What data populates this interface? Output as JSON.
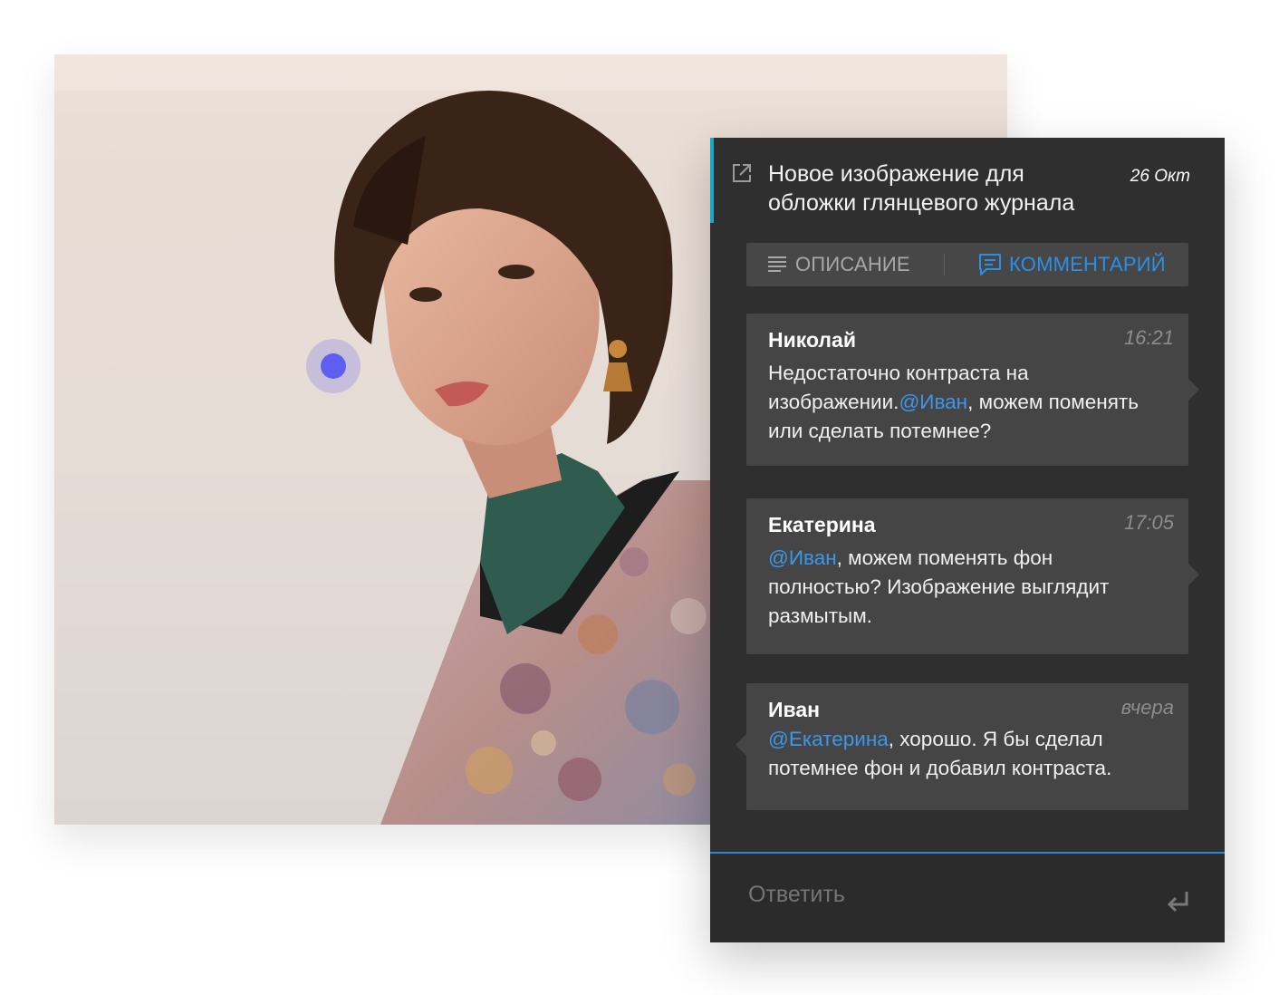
{
  "photo": {
    "annotation_pin_color": "#5f5ef0"
  },
  "panel": {
    "open_icon": "external-link-icon",
    "title": "Новое изображение для обложки глянцевого журнала",
    "date": "26 Окт",
    "accent_color": "#17a8c7",
    "tabs": [
      {
        "label": "ОПИСАНИЕ",
        "icon": "text-lines-icon",
        "active": false
      },
      {
        "label": "КОММЕНТАРИЙ",
        "icon": "comment-icon",
        "active": true
      }
    ],
    "comments": [
      {
        "author": "Николай",
        "time": "16:21",
        "text_before": "Недостаточно контраста на изображении.",
        "mention": "@Иван",
        "text_after": ", можем поменять или сделать потемнее?"
      },
      {
        "author": "Екатерина",
        "time": "17:05",
        "text_before": "",
        "mention": "@Иван",
        "text_after": ", можем поменять фон полностью? Изображение выглядит размытым."
      },
      {
        "author": "Иван",
        "time": "вчера",
        "text_before": "",
        "mention": "@Екатерина",
        "text_after": ", хорошо. Я бы сделал потемнее фон и добавил контраста."
      }
    ],
    "reply": {
      "placeholder": "Ответить",
      "send_icon": "enter-icon"
    },
    "mention_color": "#3c97ea",
    "active_tab_color": "#2c8fe6"
  }
}
